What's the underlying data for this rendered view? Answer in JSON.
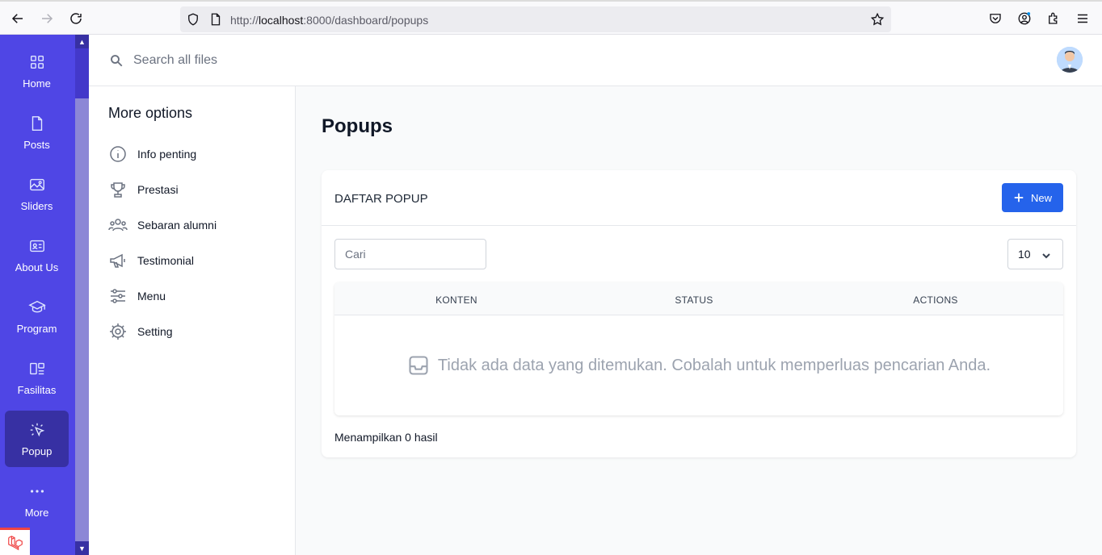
{
  "browser": {
    "url_prefix": "http://",
    "url_host": "localhost",
    "url_rest": ":8000/dashboard/popups"
  },
  "rail": {
    "items": [
      {
        "label": "Home",
        "icon": "grid-icon"
      },
      {
        "label": "Posts",
        "icon": "document-icon"
      },
      {
        "label": "Sliders",
        "icon": "image-icon"
      },
      {
        "label": "About Us",
        "icon": "id-card-icon"
      },
      {
        "label": "Program",
        "icon": "graduation-cap-icon"
      },
      {
        "label": "Fasilitas",
        "icon": "layout-icon"
      },
      {
        "label": "Popup",
        "icon": "cursor-click-icon",
        "active": true
      },
      {
        "label": "More",
        "icon": "dots-icon"
      }
    ]
  },
  "topbar": {
    "search_placeholder": "Search all files"
  },
  "sidebar": {
    "title": "More options",
    "items": [
      {
        "label": "Info penting",
        "icon": "info-icon"
      },
      {
        "label": "Prestasi",
        "icon": "trophy-icon"
      },
      {
        "label": "Sebaran alumni",
        "icon": "users-icon"
      },
      {
        "label": "Testimonial",
        "icon": "megaphone-icon"
      },
      {
        "label": "Menu",
        "icon": "sliders-icon"
      },
      {
        "label": "Setting",
        "icon": "gear-icon"
      }
    ]
  },
  "page": {
    "title": "Popups"
  },
  "card": {
    "title": "DAFTAR POPUP",
    "new_label": "New",
    "filter_placeholder": "Cari",
    "per_page": "10",
    "columns": [
      "KONTEN",
      "STATUS",
      "ACTIONS"
    ],
    "empty_message": "Tidak ada data yang ditemukan. Cobalah untuk memperluas pencarian Anda.",
    "result_summary": "Menampilkan 0 hasil"
  },
  "colors": {
    "rail": "#4f46e5",
    "rail_active": "#3730a3",
    "primary_button": "#2563eb"
  }
}
